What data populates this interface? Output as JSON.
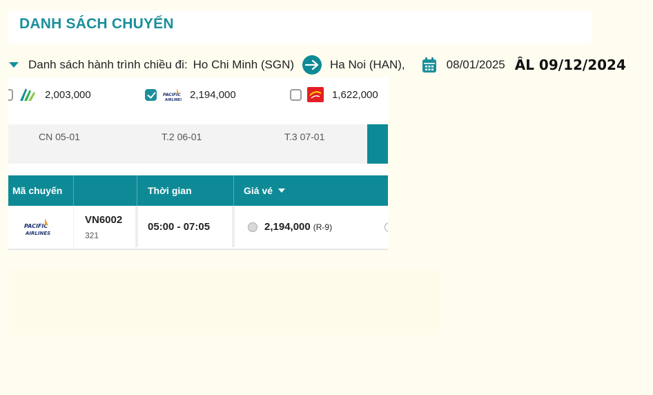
{
  "header": {
    "title": "DANH SÁCH CHUYẾN"
  },
  "route": {
    "label": "Danh sách hành trình chiều đi:",
    "origin": "Ho Chi Minh (SGN)",
    "destination": "Ha Noi (HAN),",
    "date": "08/01/2025",
    "lunar_date": "ÂL 09/12/2024"
  },
  "airlines": [
    {
      "logo": "bamboo-airways-logo",
      "price": "2,003,000",
      "checked": false
    },
    {
      "logo": "pacific-airlines-logo",
      "price": "2,194,000",
      "checked": true
    },
    {
      "logo": "vietjet-air-logo",
      "price": "1,622,000",
      "checked": false
    }
  ],
  "dates": [
    {
      "label": "CN 05-01"
    },
    {
      "label": "T.2 06-01"
    },
    {
      "label": "T.3 07-01"
    }
  ],
  "table": {
    "headers": {
      "code": "Mã chuyến",
      "time": "Thời gian",
      "price": "Giá vé"
    },
    "rows": [
      {
        "airline_logo": "pacific-airlines-logo",
        "flight_code": "VN6002",
        "aircraft": "321",
        "time": "05:00 - 07:05",
        "price": "2,194,000",
        "fare_class": "(R-9)"
      }
    ]
  },
  "colors": {
    "teal": "#0e8a96",
    "title": "#1a8f9a",
    "background": "#fffdf0"
  }
}
